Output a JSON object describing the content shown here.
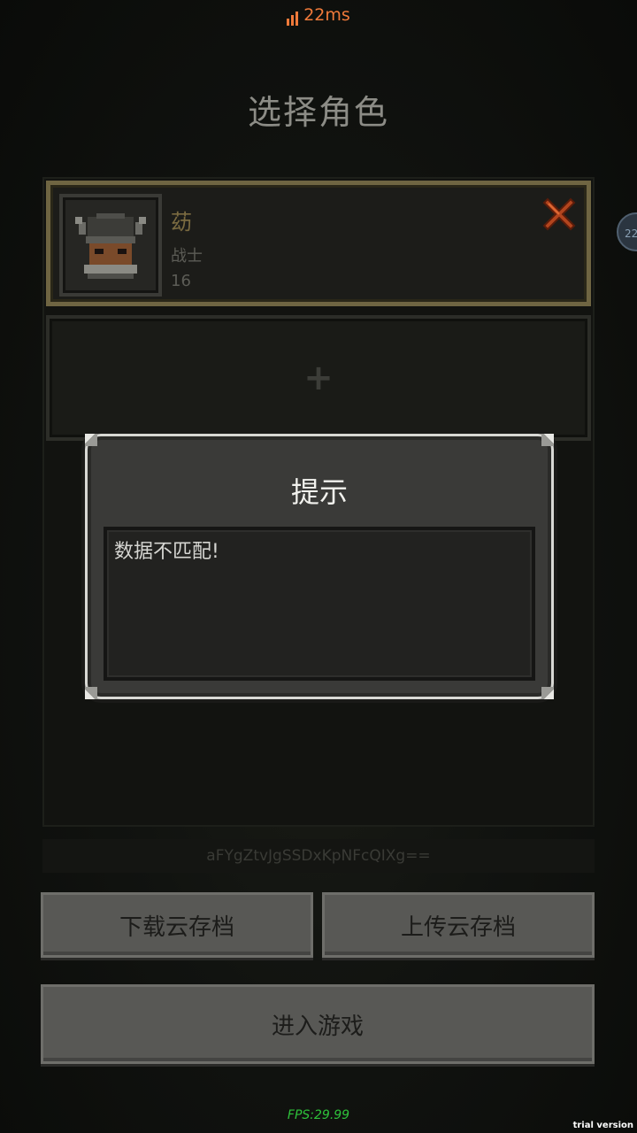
{
  "status": {
    "ping": "22ms",
    "ping_color": "#f07a3a"
  },
  "screen_title": "选择角色",
  "characters": [
    {
      "name": "苭",
      "class": "战士",
      "level": "16",
      "portrait_icon": "horned-helmet-warrior-icon",
      "delete_icon": "red-x-icon"
    }
  ],
  "empty_slot": {
    "symbol": "+"
  },
  "side_badge": {
    "text": "22"
  },
  "dialog": {
    "title": "提示",
    "message": "数据不匹配!"
  },
  "save_code": "aFYgZtvJgSSDxKpNFcQIXg==",
  "buttons": {
    "download": "下载云存档",
    "upload": "上传云存档",
    "enter": "进入游戏"
  },
  "fps": "FPS:29.99",
  "trial_label": "trial version",
  "colors": {
    "selected_border": "#6f6542",
    "name_color": "#7a6a40",
    "fps_color": "#2ec23a"
  }
}
